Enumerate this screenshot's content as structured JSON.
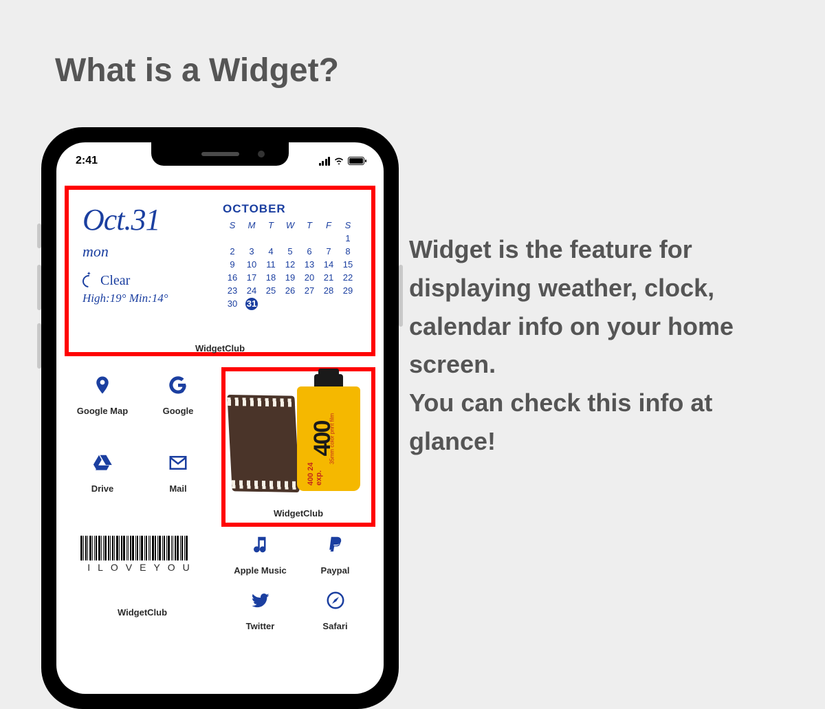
{
  "title": "What is a Widget?",
  "description": "Widget is the feature for displaying weather, clock, calendar info on your home screen.\nYou can check this info at glance!",
  "status": {
    "time": "2:41"
  },
  "calendarWidget": {
    "dateLabel": "Oct.31",
    "dayLabel": "mon",
    "weatherLabel": "Clear",
    "tempsLabel": "High:19° Min:14°",
    "monthLabel": "OCTOBER",
    "dowHeaders": [
      "S",
      "M",
      "T",
      "W",
      "T",
      "F",
      "S"
    ],
    "weeks": [
      [
        "",
        "",
        "",
        "",
        "",
        "",
        "1"
      ],
      [
        "2",
        "3",
        "4",
        "5",
        "6",
        "7",
        "8"
      ],
      [
        "9",
        "10",
        "11",
        "12",
        "13",
        "14",
        "15"
      ],
      [
        "16",
        "17",
        "18",
        "19",
        "20",
        "21",
        "22"
      ],
      [
        "23",
        "24",
        "25",
        "26",
        "27",
        "28",
        "29"
      ],
      [
        "30",
        "31",
        "",
        "",
        "",
        "",
        ""
      ]
    ],
    "today": "31",
    "footer": "WidgetClub"
  },
  "apps": {
    "googleMap": "Google Map",
    "google": "Google",
    "drive": "Drive",
    "mail": "Mail",
    "appleMusic": "Apple Music",
    "paypal": "Paypal",
    "twitter": "Twitter",
    "safari": "Safari"
  },
  "filmWidget": {
    "label": "WidgetClub",
    "bigText": "400",
    "subText": "400 24 exp.",
    "sideText": "35mm color print film"
  },
  "barcodeWidget": {
    "text": "ILOVEYOU",
    "label": "WidgetClub"
  }
}
